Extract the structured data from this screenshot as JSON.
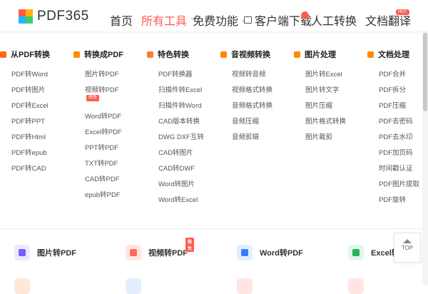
{
  "header": {
    "logo_text": "PDF365",
    "nav": [
      {
        "label": "首页",
        "caret": ""
      },
      {
        "label": "所有工具",
        "caret": "^"
      },
      {
        "label": "免费功能",
        "caret": "v"
      },
      {
        "label": "客户端下载",
        "caret": "v"
      },
      {
        "label": "人工转换",
        "caret": ""
      },
      {
        "label": "文档翻译",
        "caret": ""
      }
    ],
    "hot_badge": "HOT",
    "accent_color": "#ff5a4e"
  },
  "menu": {
    "columns": [
      {
        "title": "从PDF转换",
        "icon": "pdf-from-icon",
        "items": [
          "PDF转Word",
          "PDF转图片",
          "PDF转Excel",
          "PDF转PPT",
          "PDF转Html",
          "PDF转epub",
          "PDF转CAD"
        ]
      },
      {
        "title": "转换成PDF",
        "icon": "pdf-to-icon",
        "items": [
          "图片转PDF",
          "视频转PDF",
          "Word转PDF",
          "Excel转PDF",
          "PPT转PDF",
          "TXT转PDF",
          "CAD转PDF",
          "epub转PDF"
        ],
        "badge": "限免"
      },
      {
        "title": "特色转换",
        "icon": "special-icon",
        "items": [
          "PDF转换器",
          "扫描件转Excel",
          "扫描件转Word",
          "CAD版本转换",
          "DWG DXF互转",
          "CAD转图片",
          "CAD转DWF",
          "Word转图片",
          "Word转Excel"
        ]
      },
      {
        "title": "音视频转换",
        "icon": "media-icon",
        "items": [
          "视频转音频",
          "视频格式转换",
          "音频格式转换",
          "音频压缩",
          "音频剪辑"
        ]
      },
      {
        "title": "图片处理",
        "icon": "image-icon",
        "items": [
          "图片转Excel",
          "图片转文字",
          "图片压缩",
          "图片格式转换",
          "图片裁剪"
        ]
      },
      {
        "title": "文档处理",
        "icon": "doc-icon",
        "items": [
          "PDF合并",
          "PDF拆分",
          "PDF压缩",
          "PDF去密码",
          "PDF去水印",
          "PDF加页码",
          "时间戳认证",
          "PDF图片提取",
          "PDF旋转"
        ]
      }
    ]
  },
  "cards": [
    {
      "label": "图片转PDF",
      "badge": ""
    },
    {
      "label": "视频转PDF",
      "badge": "限免"
    },
    {
      "label": "Word转PDF",
      "badge": ""
    },
    {
      "label": "Excel转",
      "badge": ""
    }
  ],
  "top_button": "TOP"
}
